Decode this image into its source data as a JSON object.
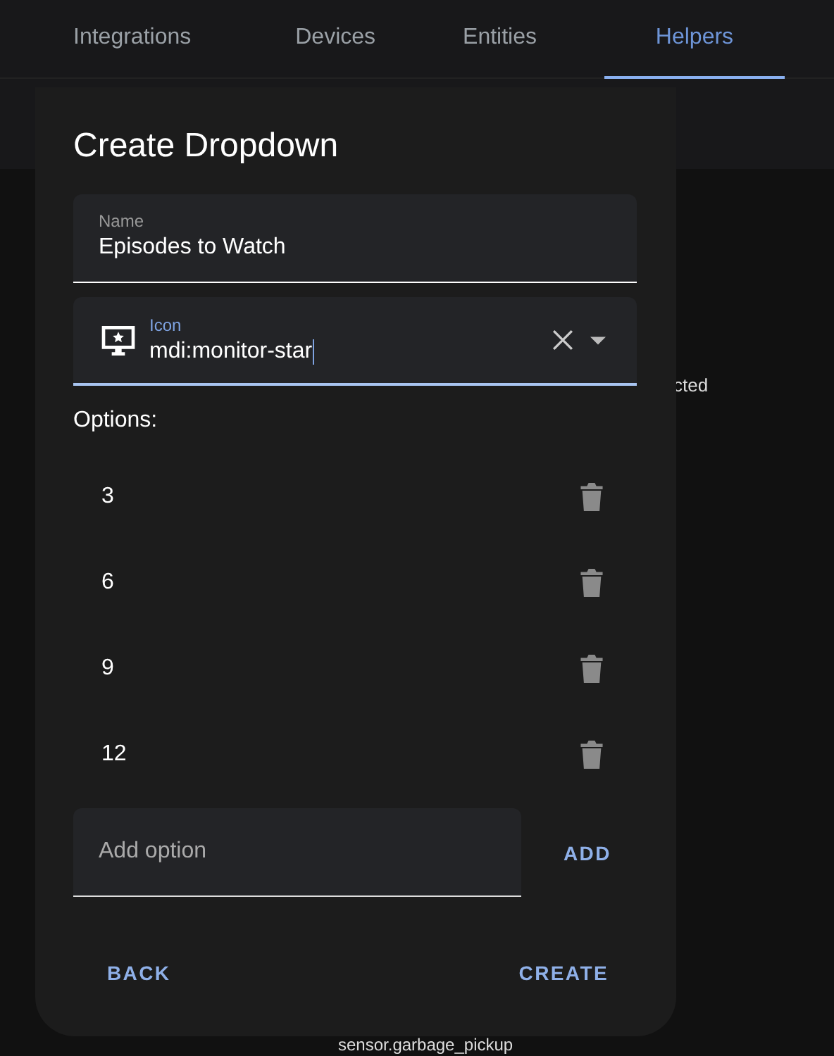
{
  "tabs": [
    {
      "label": "Integrations",
      "selected": false
    },
    {
      "label": "Devices",
      "selected": false
    },
    {
      "label": "Entities",
      "selected": false
    },
    {
      "label": "Helpers",
      "selected": true
    }
  ],
  "background_texts": [
    "cted",
    "sensor.garbage_pickup"
  ],
  "dialog": {
    "title": "Create Dropdown",
    "name_field": {
      "label": "Name",
      "value": "Episodes to Watch"
    },
    "icon_field": {
      "label": "Icon",
      "value": "mdi:monitor-star",
      "focused": true
    },
    "options_label": "Options:",
    "options": [
      "3",
      "6",
      "9",
      "12"
    ],
    "add_option": {
      "placeholder": "Add option",
      "button": "ADD"
    },
    "buttons": [
      "BACK",
      "CREATE"
    ]
  }
}
